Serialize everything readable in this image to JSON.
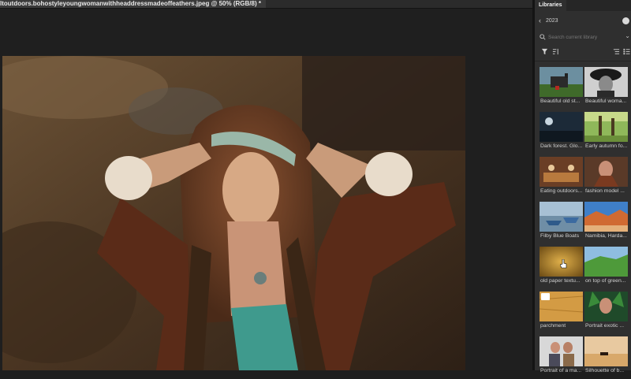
{
  "document": {
    "tab_title": "ltoutdoors.bohostyleyoungwomanwithheaddressmadeoffeathers.jpeg @ 50% (RGB/8) *"
  },
  "panel": {
    "tab_label": "Libraries",
    "library_name": "2023",
    "search_placeholder": "Search current library",
    "icons": [
      "filter-icon",
      "sort-icon",
      "list-view-icon",
      "grid-view-icon"
    ]
  },
  "library_items": [
    {
      "label": "Beautiful old st..."
    },
    {
      "label": "Beautiful woma..."
    },
    {
      "label": "Dark forest. Glo..."
    },
    {
      "label": "Early autumn fo..."
    },
    {
      "label": "Eating outdoors..."
    },
    {
      "label": "fashion model ..."
    },
    {
      "label": "Filby Blue Boats"
    },
    {
      "label": "Namibia, Harda..."
    },
    {
      "label": "old paper textu..."
    },
    {
      "label": "on top of green..."
    },
    {
      "label": "parchment"
    },
    {
      "label": "Portrait exotic ..."
    },
    {
      "label": "Portrait of a ma..."
    },
    {
      "label": "Silhouette of b..."
    }
  ]
}
